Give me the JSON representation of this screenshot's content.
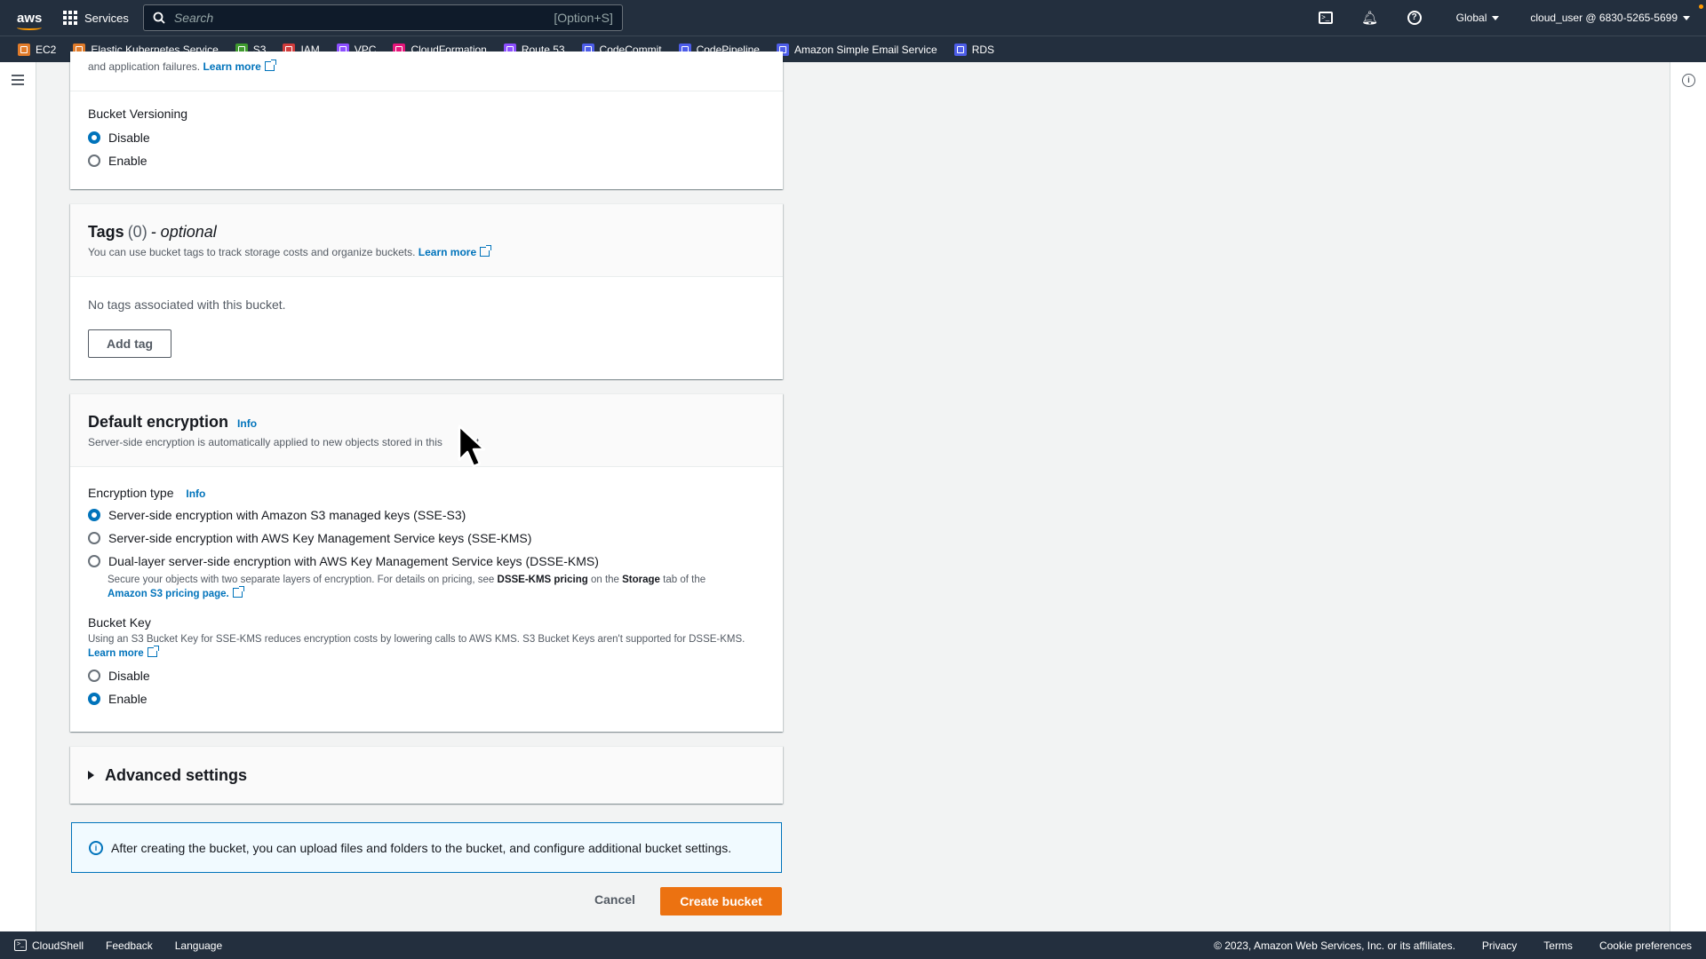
{
  "topbar": {
    "logo": "aws",
    "services_label": "Services",
    "search_placeholder": "Search",
    "search_shortcut": "[Option+S]",
    "region": "Global",
    "account": "cloud_user @ 6830-5265-5699"
  },
  "favorites": [
    {
      "label": "EC2",
      "color": "#e07b2a"
    },
    {
      "label": "Elastic Kubernetes Service",
      "color": "#e07b2a"
    },
    {
      "label": "S3",
      "color": "#3f9b2f"
    },
    {
      "label": "IAM",
      "color": "#d13c3c"
    },
    {
      "label": "VPC",
      "color": "#8c4fff"
    },
    {
      "label": "CloudFormation",
      "color": "#e7157b"
    },
    {
      "label": "Route 53",
      "color": "#8c4fff"
    },
    {
      "label": "CodeCommit",
      "color": "#4d5de8"
    },
    {
      "label": "CodePipeline",
      "color": "#4d5de8"
    },
    {
      "label": "Amazon Simple Email Service",
      "color": "#4d5de8"
    },
    {
      "label": "RDS",
      "color": "#4d5de8"
    }
  ],
  "top_fragment": {
    "text": "and application failures.",
    "learn_more": "Learn more"
  },
  "versioning": {
    "label": "Bucket Versioning",
    "options": [
      "Disable",
      "Enable"
    ],
    "selected": "Disable"
  },
  "tags": {
    "title": "Tags",
    "count": "(0)",
    "optional": "- optional",
    "description": "You can use bucket tags to track storage costs and organize buckets.",
    "learn_more": "Learn more",
    "empty_text": "No tags associated with this bucket.",
    "add_button": "Add tag"
  },
  "encryption": {
    "title": "Default encryption",
    "info": "Info",
    "description_part1": "Server-side encryption is automatically applied to new objects stored in this",
    "description_part2": "ket.",
    "type_label": "Encryption type",
    "type_info": "Info",
    "options": [
      "Server-side encryption with Amazon S3 managed keys (SSE-S3)",
      "Server-side encryption with AWS Key Management Service keys (SSE-KMS)",
      "Dual-layer server-side encryption with AWS Key Management Service keys (DSSE-KMS)"
    ],
    "selected_index": 0,
    "dsse_sub_1": "Secure your objects with two separate layers of encryption. For details on pricing, see",
    "dsse_sub_bold1": "DSSE-KMS pricing",
    "dsse_sub_2": "on the",
    "dsse_sub_bold2": "Storage",
    "dsse_sub_3": "tab of the",
    "dsse_sub_link": "Amazon S3 pricing page.",
    "bucket_key_label": "Bucket Key",
    "bucket_key_desc": "Using an S3 Bucket Key for SSE-KMS reduces encryption costs by lowering calls to AWS KMS. S3 Bucket Keys aren't supported for DSSE-KMS.",
    "bucket_key_learn_more": "Learn more",
    "bucket_key_options": [
      "Disable",
      "Enable"
    ],
    "bucket_key_selected": "Enable"
  },
  "advanced": {
    "title": "Advanced settings"
  },
  "alert": {
    "text": "After creating the bucket, you can upload files and folders to the bucket, and configure additional bucket settings."
  },
  "actions": {
    "cancel": "Cancel",
    "create": "Create bucket"
  },
  "footer": {
    "cloudshell": "CloudShell",
    "feedback": "Feedback",
    "language": "Language",
    "copyright": "© 2023, Amazon Web Services, Inc. or its affiliates.",
    "privacy": "Privacy",
    "terms": "Terms",
    "cookies": "Cookie preferences"
  }
}
